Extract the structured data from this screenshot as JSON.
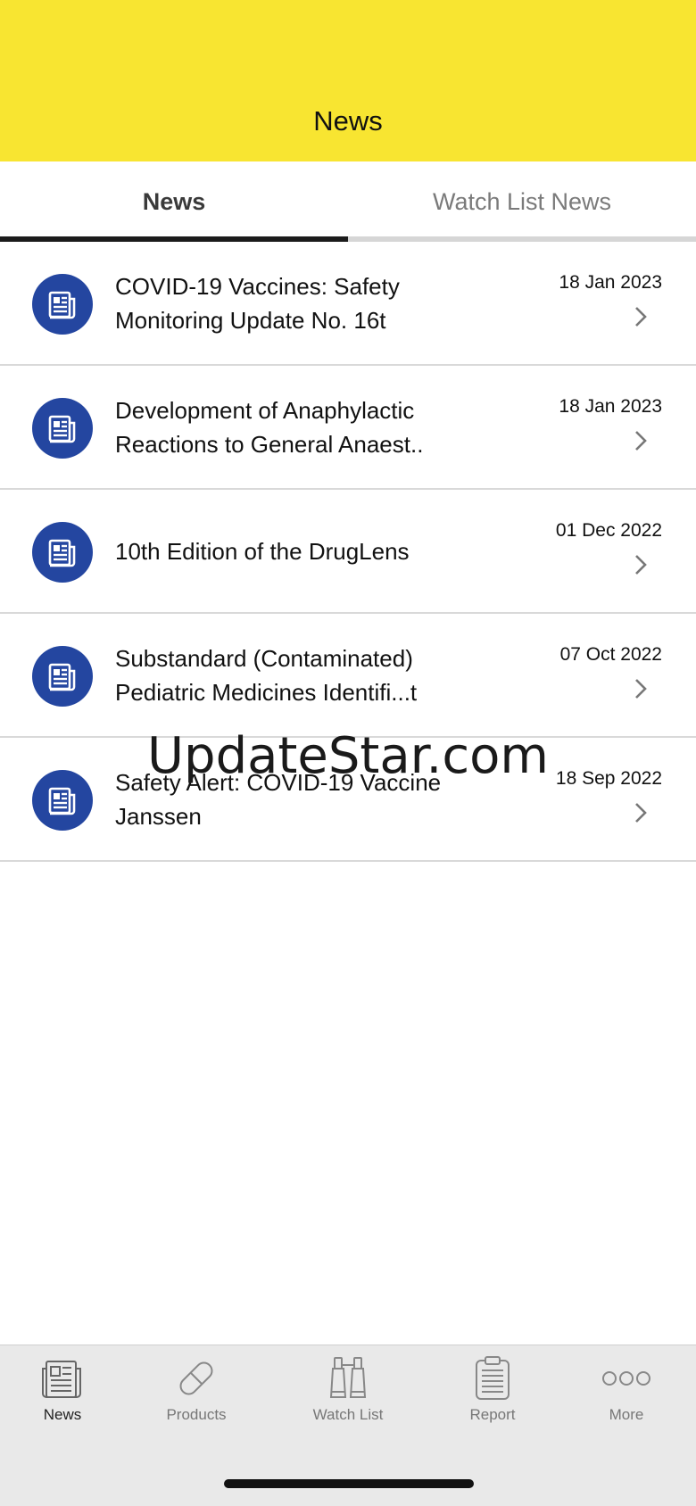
{
  "header": {
    "title": "News",
    "background": "#f8e531"
  },
  "tabs": [
    {
      "label": "News",
      "active": true
    },
    {
      "label": "Watch List News",
      "active": false
    }
  ],
  "news": [
    {
      "title": "COVID-19 Vaccines: Safety Monitoring Update No. 16t",
      "date": "18 Jan 2023",
      "icon": "newspaper-icon"
    },
    {
      "title": "Development of Anaphylactic Reactions to General Anaest..",
      "date": "18 Jan 2023",
      "icon": "newspaper-icon"
    },
    {
      "title": "10th Edition of the DrugLens",
      "date": "01 Dec 2022",
      "icon": "newspaper-icon"
    },
    {
      "title": "Substandard (Contaminated) Pediatric Medicines Identifi...t",
      "date": "07 Oct 2022",
      "icon": "newspaper-icon"
    },
    {
      "title": "Safety Alert: COVID-19 Vaccine Janssen",
      "date": "18 Sep 2022",
      "icon": "newspaper-icon"
    }
  ],
  "watermark": "UpdateStar.com",
  "bottom_nav": [
    {
      "label": "News",
      "icon": "newspaper-icon",
      "active": true
    },
    {
      "label": "Products",
      "icon": "pill-icon",
      "active": false
    },
    {
      "label": "Watch List",
      "icon": "binoculars-icon",
      "active": false
    },
    {
      "label": "Report",
      "icon": "clipboard-icon",
      "active": false
    },
    {
      "label": "More",
      "icon": "more-dots-icon",
      "active": false
    }
  ],
  "colors": {
    "accent_blue": "#2446a0",
    "header_yellow": "#f8e531",
    "tab_active": "#1b1b1b"
  }
}
